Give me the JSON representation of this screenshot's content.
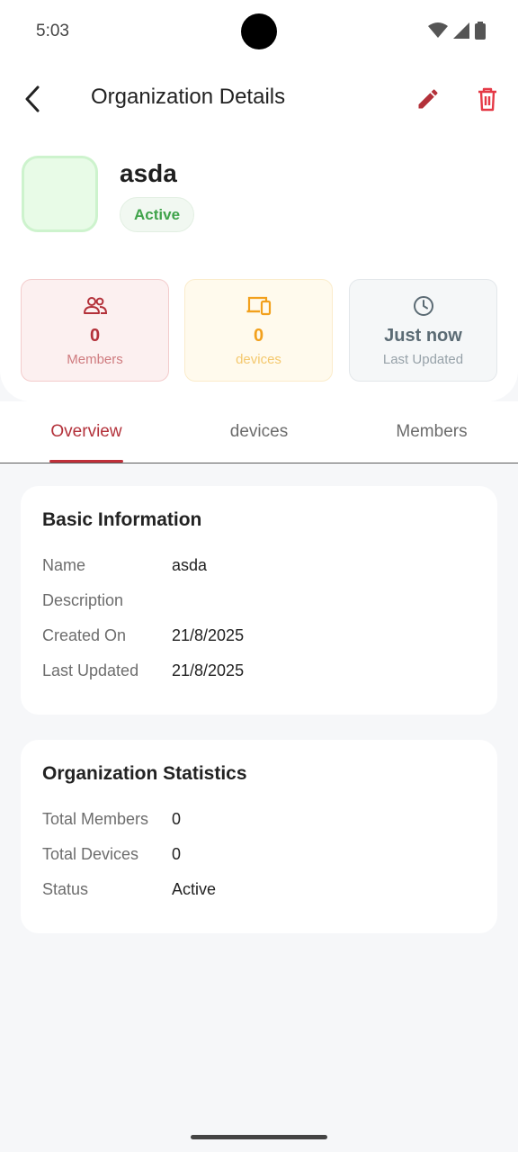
{
  "status_bar": {
    "time": "5:03"
  },
  "header": {
    "title": "Organization Details"
  },
  "organization": {
    "name": "asda",
    "status": "Active"
  },
  "stats": {
    "members": {
      "value": "0",
      "label": "Members"
    },
    "devices": {
      "value": "0",
      "label": "devices"
    },
    "updated": {
      "value": "Just now",
      "label": "Last Updated"
    }
  },
  "tabs": [
    {
      "label": "Overview",
      "active": true
    },
    {
      "label": "devices",
      "active": false
    },
    {
      "label": "Members",
      "active": false
    }
  ],
  "basic_info": {
    "title": "Basic Information",
    "rows": [
      {
        "label": "Name",
        "value": "asda"
      },
      {
        "label": "Description",
        "value": ""
      },
      {
        "label": "Created On",
        "value": "21/8/2025"
      },
      {
        "label": "Last Updated",
        "value": "21/8/2025"
      }
    ]
  },
  "org_stats": {
    "title": "Organization Statistics",
    "rows": [
      {
        "label": "Total Members",
        "value": "0"
      },
      {
        "label": "Total Devices",
        "value": "0"
      },
      {
        "label": "Status",
        "value": "Active"
      }
    ]
  },
  "colors": {
    "accent": "#b3313a",
    "success": "#3fa34a",
    "warning": "#f2a01c",
    "neutral": "#5b6b74"
  },
  "icons": [
    "wifi-icon",
    "signal-icon",
    "battery-icon",
    "back-arrow-icon",
    "edit-pencil-icon",
    "trash-icon",
    "members-icon",
    "devices-icon",
    "clock-icon"
  ]
}
